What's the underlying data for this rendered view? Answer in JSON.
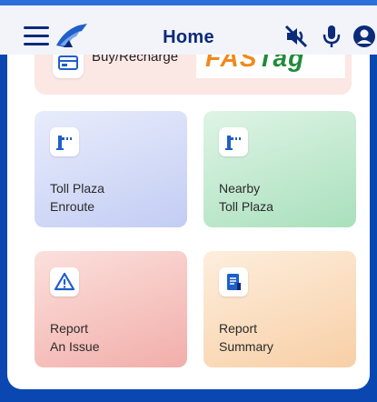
{
  "header": {
    "title": "Home",
    "menu_icon": "hamburger-icon",
    "logo_icon": "nhai-logo-icon",
    "mute_icon": "speaker-mute-icon",
    "mic_icon": "microphone-icon",
    "profile_icon": "profile-icon"
  },
  "banner": {
    "label": "Buy/Recharge",
    "brand_text_1": "FAS",
    "brand_text_2": "Tag",
    "icon": "card-icon"
  },
  "tiles": [
    {
      "line1": "Toll Plaza",
      "line2": "Enroute",
      "icon": "toll-barrier-icon",
      "color": "#c3cdf4"
    },
    {
      "line1": "Nearby",
      "line2": "Toll Plaza",
      "icon": "toll-barrier-icon",
      "color": "#a9e0bc"
    },
    {
      "line1": "Report",
      "line2": "An Issue",
      "icon": "warning-icon",
      "color": "#f2aeaa"
    },
    {
      "line1": "Report",
      "line2": "Summary",
      "icon": "document-icon",
      "color": "#f8cfa6"
    }
  ],
  "colors": {
    "brand_blue": "#0b47b1",
    "title_blue": "#0b2a7a"
  }
}
